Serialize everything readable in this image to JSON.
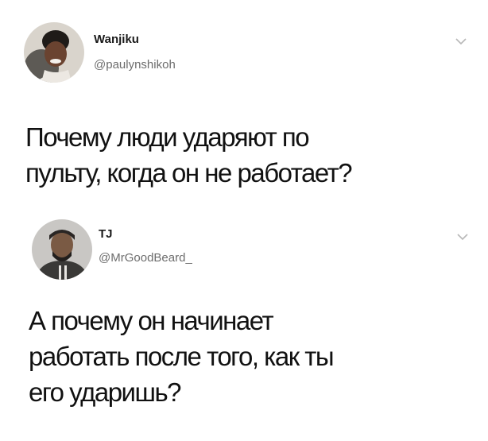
{
  "tweets": [
    {
      "display_name": "Wanjiku",
      "handle": "@paulynshikoh",
      "text_lines": [
        "Почему люди ударяют по",
        "пульту, когда он не работает?"
      ],
      "avatar_icon": "profile-photo-woman",
      "menu_icon": "chevron-down-icon"
    },
    {
      "display_name": "TJ",
      "handle": "@MrGoodBeard_",
      "text_lines": [
        "А почему он начинает",
        "работать после того, как ты",
        "его ударишь?"
      ],
      "avatar_icon": "profile-photo-man",
      "menu_icon": "chevron-down-icon"
    }
  ],
  "colors": {
    "background": "#ffffff",
    "text": "#111111",
    "handle": "#6d6d6d",
    "chevron": "#b8b8b8"
  }
}
